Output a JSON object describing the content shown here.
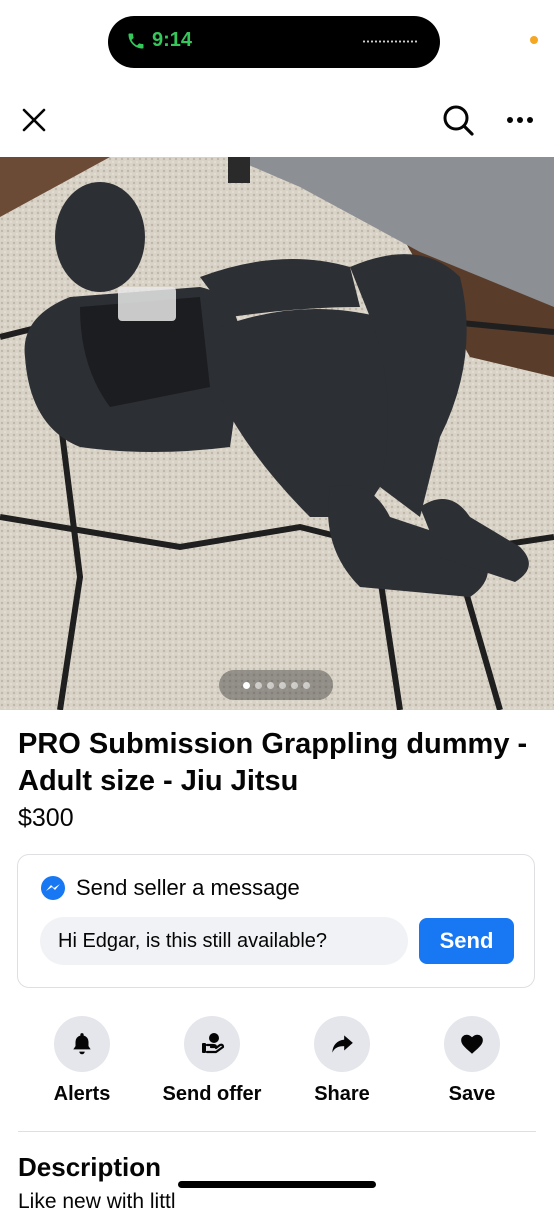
{
  "status": {
    "time": "9:14",
    "phone_icon": "phone-icon"
  },
  "nav": {
    "close_icon": "close-icon",
    "search_icon": "search-icon",
    "more_icon": "more-icon"
  },
  "photo": {
    "subject": "grappling-dummy-photo",
    "pages": 6,
    "current_page": 1
  },
  "listing": {
    "title": "PRO Submission Grappling dummy - Adult size - Jiu Jitsu",
    "price": "$300"
  },
  "message": {
    "header": "Send seller a message",
    "input_value": "Hi Edgar, is this still available?",
    "send_label": "Send"
  },
  "actions": [
    {
      "label": "Alerts",
      "icon": "bell-icon"
    },
    {
      "label": "Send offer",
      "icon": "offer-icon"
    },
    {
      "label": "Share",
      "icon": "share-icon"
    },
    {
      "label": "Save",
      "icon": "heart-icon"
    }
  ],
  "description": {
    "heading": "Description",
    "text": "Like new with littl"
  },
  "colors": {
    "accent": "#1877f2",
    "call_green": "#34c759",
    "surface": "#e4e6eb"
  }
}
